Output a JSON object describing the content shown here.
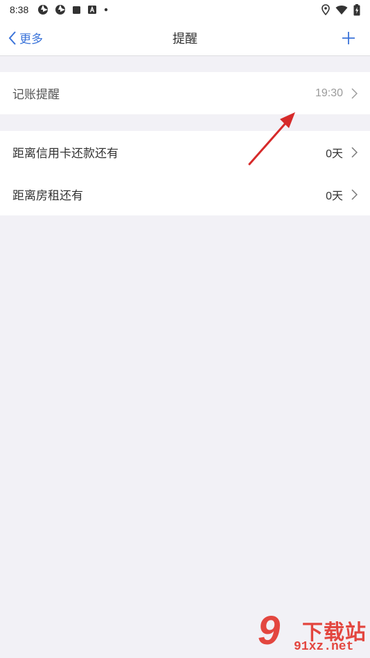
{
  "status_bar": {
    "time": "8:38",
    "left_icons": [
      "aperture-icon",
      "aperture-icon",
      "square-icon",
      "a-box-icon",
      "dot-icon"
    ],
    "right_icons": [
      "location-pin-icon",
      "wifi-icon",
      "battery-charging-icon"
    ]
  },
  "nav": {
    "back_label": "更多",
    "title": "提醒"
  },
  "groups": [
    {
      "rows": [
        {
          "label": "记账提醒",
          "value": "19:30"
        }
      ]
    },
    {
      "rows": [
        {
          "label": "距离信用卡还款还有",
          "value": "0天"
        },
        {
          "label": "距离房租还有",
          "value": "0天"
        }
      ]
    }
  ],
  "colors": {
    "accent": "#3a73d9",
    "background": "#f2f1f6",
    "annotation": "#d62a2a"
  },
  "watermark": {
    "logo_number": "9",
    "brand": "下载站",
    "url": "91xz.net"
  }
}
